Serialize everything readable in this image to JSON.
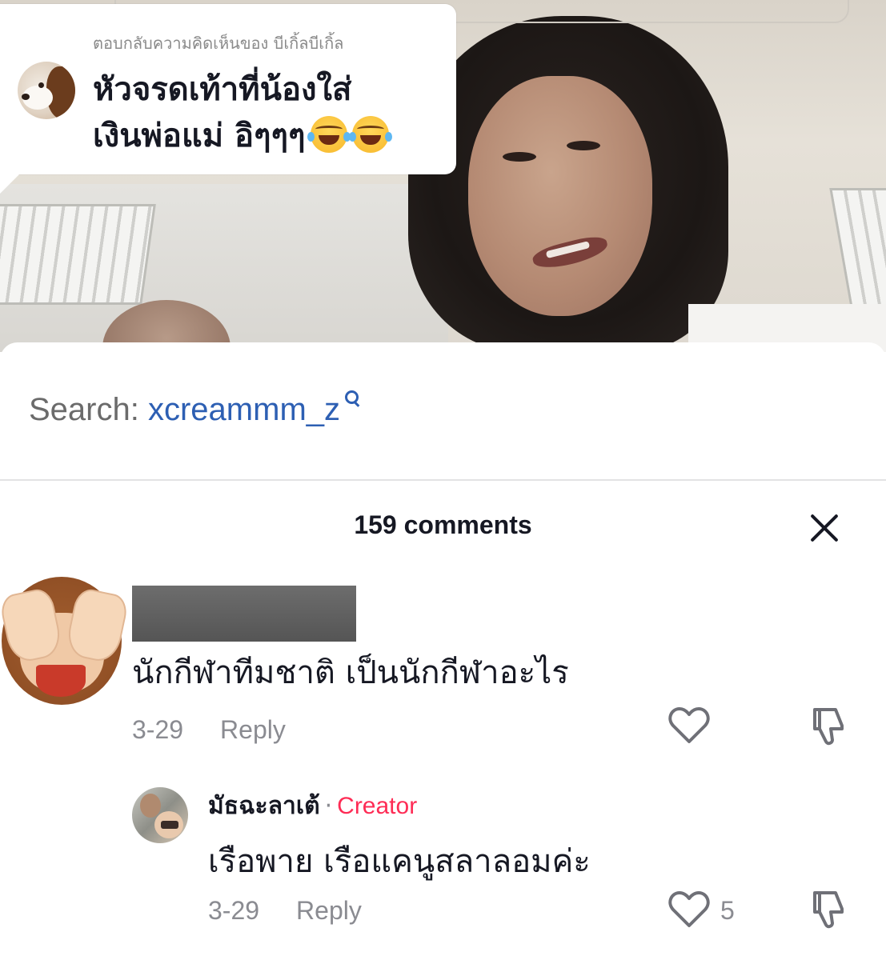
{
  "reply_bubble": {
    "reply_to": "ตอบกลับความคิดเห็นของ บีเกิ้ลบีเกิ้ล",
    "line1": "หัวจรดเท้าที่น้องใส่",
    "line2": "เงินพ่อแม่ อิๆๆๆ"
  },
  "search": {
    "label": "Search:",
    "term": "xcreammm_z"
  },
  "comments_header": {
    "count_label": "159 comments"
  },
  "comments": [
    {
      "text": "นักกีฬาทีมชาติ เป็นนักกีฬาอะไร",
      "date": "3-29",
      "reply_label": "Reply"
    }
  ],
  "reply": {
    "username": "มัธฉะลาเต้",
    "separator": "·",
    "badge": "Creator",
    "text": "เรือพาย เรือแคนูสลาลอมค่ะ",
    "date": "3-29",
    "reply_label": "Reply",
    "likes": "5"
  },
  "colors": {
    "accent": "#fe2c55",
    "link": "#2d5fb3",
    "muted": "#8a8b91",
    "text": "#161823"
  },
  "icons": [
    "search-icon",
    "close-icon",
    "heart-icon",
    "dislike-icon",
    "laughing-tears-emoji",
    "see-no-evil-monkey-emoji"
  ]
}
